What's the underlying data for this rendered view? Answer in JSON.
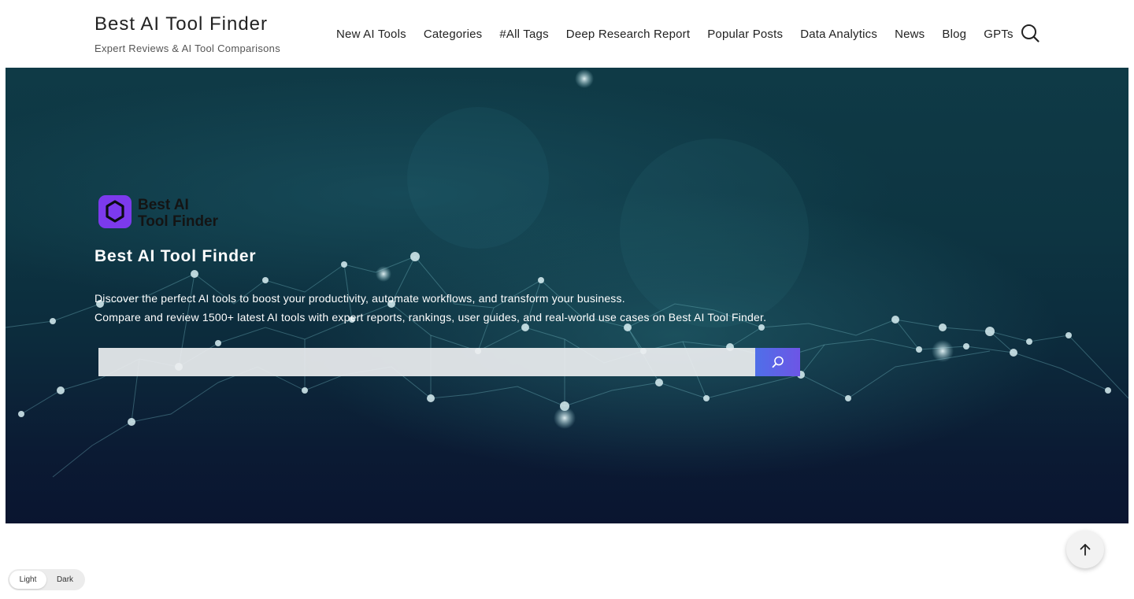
{
  "site": {
    "title": "Best AI Tool Finder",
    "tagline": "Expert Reviews & AI Tool Comparisons"
  },
  "nav": {
    "items": [
      {
        "label": "New AI Tools"
      },
      {
        "label": "Categories"
      },
      {
        "label": "#All Tags"
      },
      {
        "label": "Deep Research Report"
      },
      {
        "label": "Popular Posts"
      },
      {
        "label": "Data Analytics"
      },
      {
        "label": "News"
      },
      {
        "label": "Blog"
      },
      {
        "label": "GPTs"
      }
    ],
    "search_icon": "search-icon"
  },
  "hero": {
    "logo_text_line1": "Best AI",
    "logo_text_line2": "Tool Finder",
    "title": "Best AI Tool Finder",
    "desc_line1": "Discover the perfect AI tools to boost your productivity, automate workflows, and transform your business.",
    "desc_line2": "Compare and review 1500+ latest AI tools with expert reports, rankings, user guides, and real-world use cases on Best AI Tool Finder.",
    "search_placeholder": "",
    "search_button_icon": "search-icon"
  },
  "mode_toggle": {
    "light_label": "Light",
    "dark_label": "Dark",
    "active": "light"
  },
  "back_to_top_icon": "arrow-up-icon",
  "colors": {
    "accent_gradient_start": "#4f6fe8",
    "accent_gradient_end": "#6d55e6",
    "logo_purple": "#7c3aed",
    "hero_bg_dark": "#0b1a33"
  }
}
